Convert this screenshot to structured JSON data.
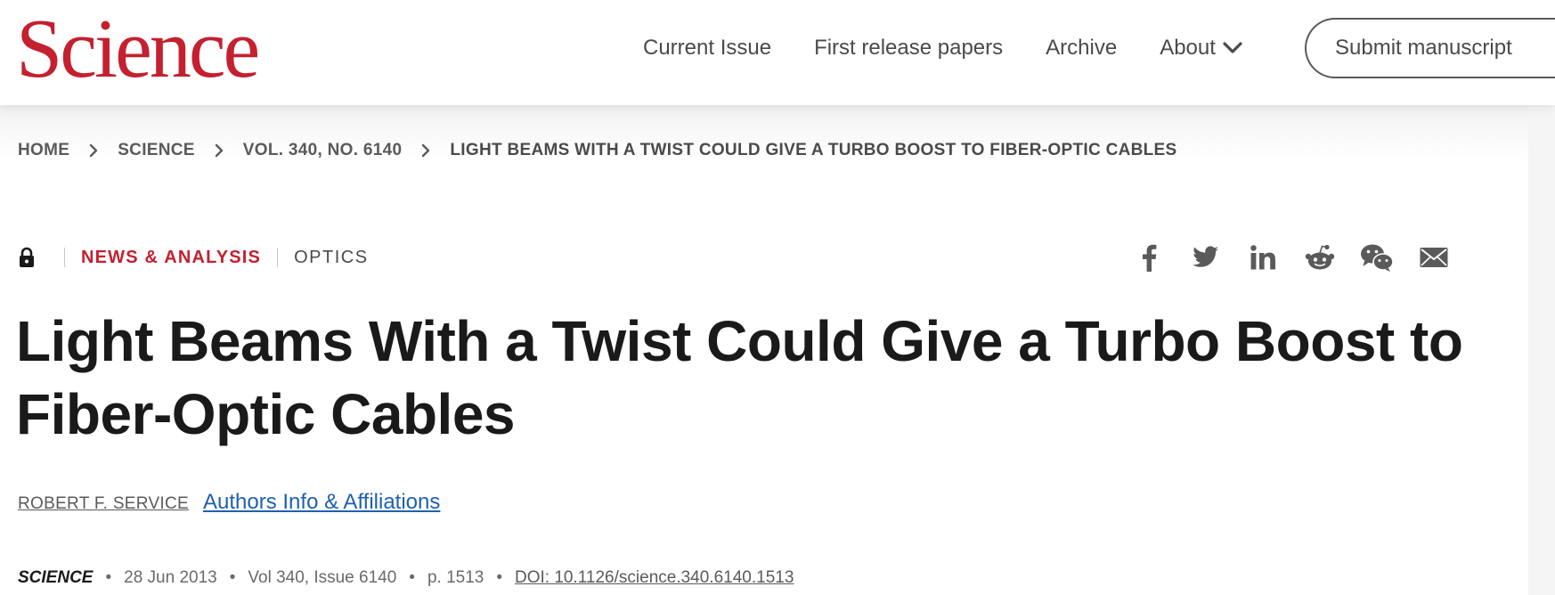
{
  "header": {
    "logo_text": "Science",
    "nav": [
      {
        "label": "Current Issue"
      },
      {
        "label": "First release papers"
      },
      {
        "label": "Archive"
      },
      {
        "label": "About"
      }
    ],
    "submit_label": "Submit manuscript"
  },
  "breadcrumb": {
    "items": [
      "HOME",
      "SCIENCE",
      "VOL. 340, NO. 6140",
      "LIGHT BEAMS WITH A TWIST COULD GIVE A TURBO BOOST TO FIBER-OPTIC CABLES"
    ]
  },
  "article": {
    "access_icon": "lock-icon",
    "section": "NEWS & ANALYSIS",
    "subject": "OPTICS",
    "title": "Light Beams With a Twist Could Give a Turbo Boost to Fiber-Optic Cables",
    "author": "ROBERT F. SERVICE",
    "affiliations_link": "Authors Info & Affiliations",
    "citation": {
      "journal": "SCIENCE",
      "date": "28 Jun 2013",
      "volume_issue": "Vol 340, Issue 6140",
      "pages": "p. 1513",
      "doi": "DOI: 10.1126/science.340.6140.1513"
    }
  },
  "share_icons": [
    "facebook-icon",
    "twitter-icon",
    "linkedin-icon",
    "reddit-icon",
    "wechat-icon",
    "email-icon"
  ],
  "colors": {
    "brand_red": "#c4202f",
    "link_blue": "#1e60b0",
    "text_dark": "#1a1a1a",
    "text_gray": "#5a5a5a"
  }
}
